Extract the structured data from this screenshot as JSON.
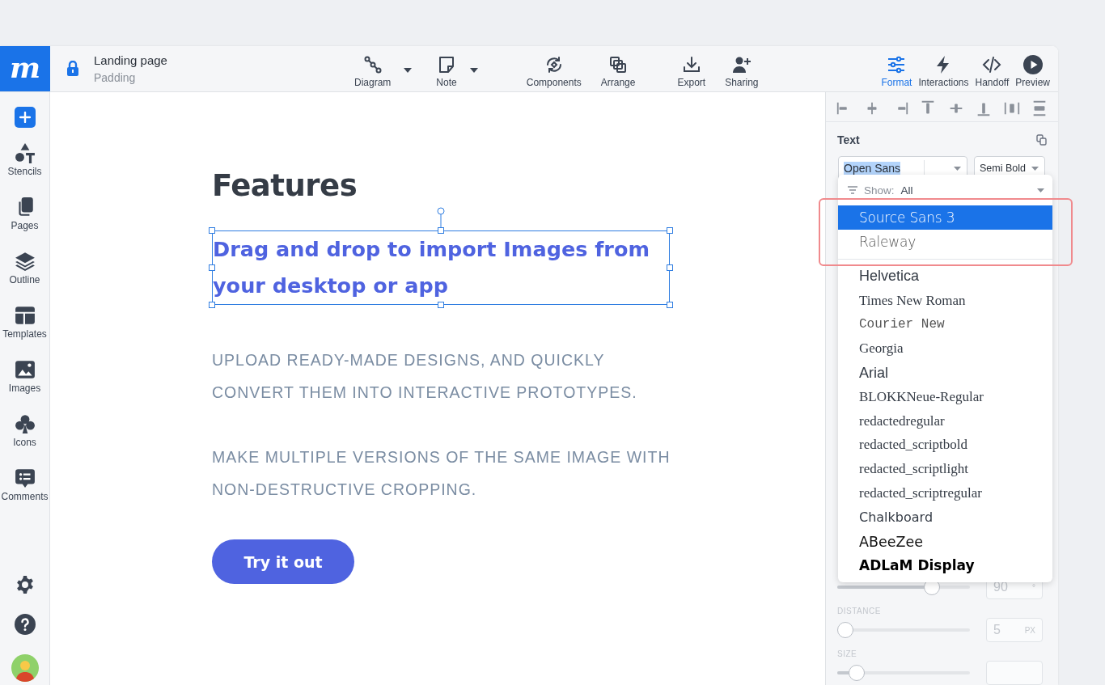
{
  "logo": "m",
  "document": {
    "title": "Landing page",
    "subtitle": "Padding"
  },
  "tools": [
    {
      "label": "Diagram",
      "caret": true
    },
    {
      "label": "Note",
      "caret": true
    },
    {
      "label": "Components",
      "caret": false
    },
    {
      "label": "Arrange",
      "caret": false
    },
    {
      "label": "Export",
      "caret": false
    },
    {
      "label": "Sharing",
      "caret": false
    }
  ],
  "mode_tabs": [
    {
      "label": "Format",
      "selected": true
    },
    {
      "label": "Interactions",
      "selected": false
    },
    {
      "label": "Handoff",
      "selected": false
    },
    {
      "label": "Preview",
      "selected": false
    }
  ],
  "sidebar": {
    "items": [
      {
        "label": "Stencils"
      },
      {
        "label": "Pages"
      },
      {
        "label": "Outline"
      },
      {
        "label": "Templates"
      },
      {
        "label": "Images"
      },
      {
        "label": "Icons"
      },
      {
        "label": "Comments"
      }
    ]
  },
  "canvas": {
    "heading": "Features",
    "selected_text": "Drag and drop to import Images from your desktop or app",
    "paragraphs": [
      "UPLOAD READY-MADE DESIGNS, AND QUICKLY CONVERT THEM INTO INTERACTIVE PROTOTYPES.",
      "MAKE MULTIPLE VERSIONS OF THE SAME IMAGE WITH NON-DESTRUCTIVE CROPPING."
    ],
    "button": "Try it out"
  },
  "panel": {
    "section_title": "Text",
    "font_select": "Open Sans",
    "weight_select": "Semi Bold",
    "sliders": [
      {
        "level": 0.74,
        "value": "90",
        "unit": "°"
      },
      {
        "label": "DISTANCE",
        "level": 0.0,
        "value": "5",
        "unit": "PX"
      },
      {
        "label": "SIZE",
        "level": 0.1
      }
    ]
  },
  "font_dropdown": {
    "filter_label": "Show:",
    "filter_value": "All",
    "recent": [
      {
        "name": "Source Sans 3",
        "kind": "light",
        "selected": true
      },
      {
        "name": "Raleway",
        "kind": "light",
        "selected": false
      }
    ],
    "fonts": [
      {
        "name": "Helvetica",
        "kind": "sans",
        "selected": false
      },
      {
        "name": "Times New Roman",
        "kind": "serif",
        "selected": false
      },
      {
        "name": "Courier New",
        "kind": "mono",
        "selected": false
      },
      {
        "name": "Georgia",
        "kind": "serif",
        "selected": false
      },
      {
        "name": "Arial",
        "kind": "sans",
        "selected": false
      },
      {
        "name": "BLOKKNeue-Regular",
        "kind": "serif",
        "selected": false
      },
      {
        "name": "redactedregular",
        "kind": "serif",
        "selected": false
      },
      {
        "name": "redacted_scriptbold",
        "kind": "serif",
        "selected": false
      },
      {
        "name": "redacted_scriptlight",
        "kind": "serif",
        "selected": false
      },
      {
        "name": "redacted_scriptregular",
        "kind": "serif",
        "selected": false
      },
      {
        "name": "Chalkboard",
        "kind": "rounded",
        "selected": false
      },
      {
        "name": "ABeeZee",
        "kind": "wide",
        "selected": false
      },
      {
        "name": "ADLaM Display",
        "kind": "heavy",
        "selected": false
      }
    ]
  }
}
